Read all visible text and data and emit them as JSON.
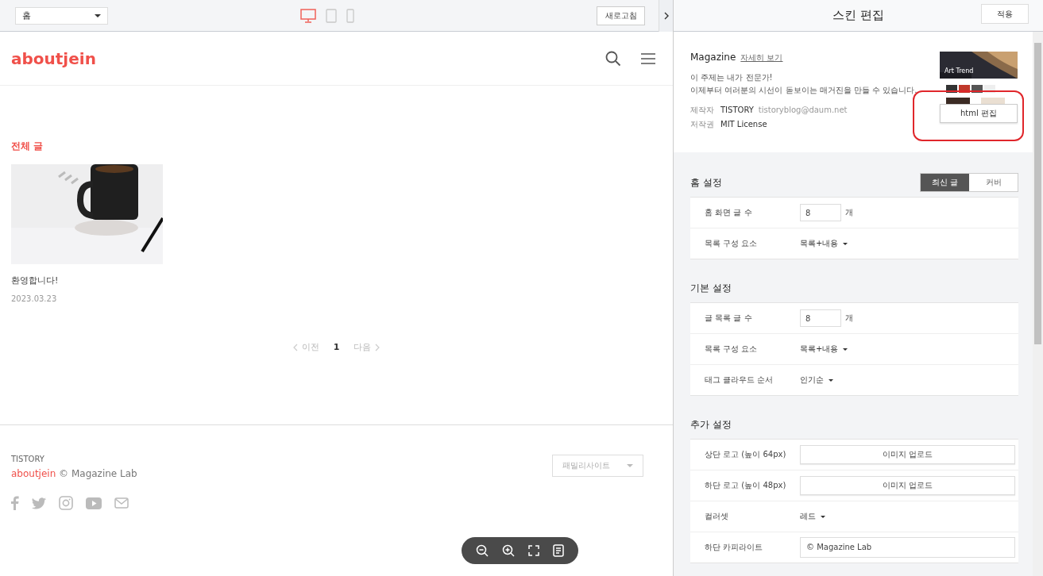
{
  "preview": {
    "page_select": "홈",
    "devices": [
      {
        "kind": "desktop",
        "selected": true
      },
      {
        "kind": "tablet",
        "selected": false
      },
      {
        "kind": "mobile",
        "selected": false
      }
    ],
    "refresh_button": "새로고침",
    "blog": {
      "logo": "aboutjein",
      "section_title": "전체 글",
      "posts": [
        {
          "title": "환영합니다!",
          "date": "2023.03.23"
        }
      ],
      "pagination": {
        "prev": "이전",
        "pages": [
          {
            "label": "1",
            "selected": true
          }
        ],
        "next": "다음"
      },
      "footer": {
        "brand": "TISTORY",
        "blog_name": "aboutjein",
        "copyright": "© Magazine Lab",
        "family_site": "패밀리사이트"
      }
    }
  },
  "editor": {
    "title": "스킨 편집",
    "apply_button": "적용",
    "skin": {
      "name": "Magazine",
      "details_link": "자세히 보기",
      "description": [
        "이 주제는 내가 전문가!",
        "이제부터 여러분의 시선이 돋보이는 매거진을 만들 수 있습니다."
      ],
      "meta": [
        {
          "label": "제작자",
          "value": "TISTORY",
          "extra": "tistoryblog@daum.net"
        },
        {
          "label": "저작권",
          "value": "MIT License"
        }
      ],
      "thumbnail_caption": "Art Trend",
      "html_edit_button": "html 편집"
    },
    "sections": [
      {
        "title": "홈 설정",
        "tabs": [
          {
            "label": "최신 글",
            "selected": true
          },
          {
            "label": "커버",
            "selected": false
          }
        ],
        "rows": [
          {
            "kind": "number",
            "label": "홈 화면 글 수",
            "value": "8",
            "unit": "개"
          },
          {
            "kind": "select",
            "label": "목록 구성 요소",
            "value": "목록+내용"
          }
        ]
      },
      {
        "title": "기본 설정",
        "rows": [
          {
            "kind": "number",
            "label": "글 목록 글 수",
            "value": "8",
            "unit": "개"
          },
          {
            "kind": "select",
            "label": "목록 구성 요소",
            "value": "목록+내용"
          },
          {
            "kind": "select",
            "label": "태그 클라우드 순서",
            "value": "인기순"
          }
        ]
      },
      {
        "title": "추가 설정",
        "rows": [
          {
            "kind": "upload",
            "label": "상단 로고 (높이 64px)",
            "value": "이미지 업로드"
          },
          {
            "kind": "upload",
            "label": "하단 로고 (높이 48px)",
            "value": "이미지 업로드"
          },
          {
            "kind": "select",
            "label": "컬러셋",
            "value": "레드"
          },
          {
            "kind": "text",
            "label": "하단 카피라이트",
            "value": "© Magazine Lab"
          }
        ]
      }
    ]
  }
}
